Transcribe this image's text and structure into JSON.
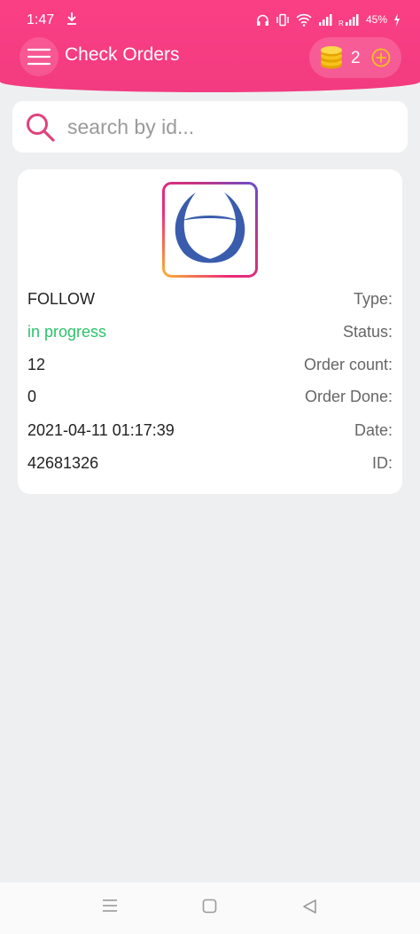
{
  "status_bar": {
    "time": "1:47",
    "battery": "45%",
    "icons": [
      "download-icon",
      "headset-icon",
      "vibrate-icon",
      "wifi-icon",
      "signal-icon",
      "roaming-signal-icon",
      "battery-charging-icon"
    ]
  },
  "app_bar": {
    "title": "Check Orders",
    "coin_count": "2",
    "menu_icon": "hamburger-menu-icon",
    "coin_icon": "coin-stack-icon",
    "add_icon": "plus-circle-icon"
  },
  "search": {
    "placeholder": "search by id...",
    "icon": "search-icon"
  },
  "order": {
    "logo_icon": "triquetra-logo-icon",
    "type_label": "Type:",
    "type_value": "FOLLOW",
    "status_label": "Status:",
    "status_value": "in progress",
    "count_label": "Order count:",
    "count_value": "12",
    "done_label": "Order Done:",
    "done_value": "0",
    "date_label": "Date:",
    "date_value": "2021-04-11 01:17:39",
    "id_label": "ID:",
    "id_value": "42681326"
  },
  "nav_bar": {
    "icons": [
      "recents-icon",
      "home-icon",
      "back-icon"
    ]
  },
  "colors": {
    "header": "#fb3f85",
    "status_green": "#2cc36b",
    "background": "#eeeff1",
    "logo_blue": "#3a5cad"
  }
}
